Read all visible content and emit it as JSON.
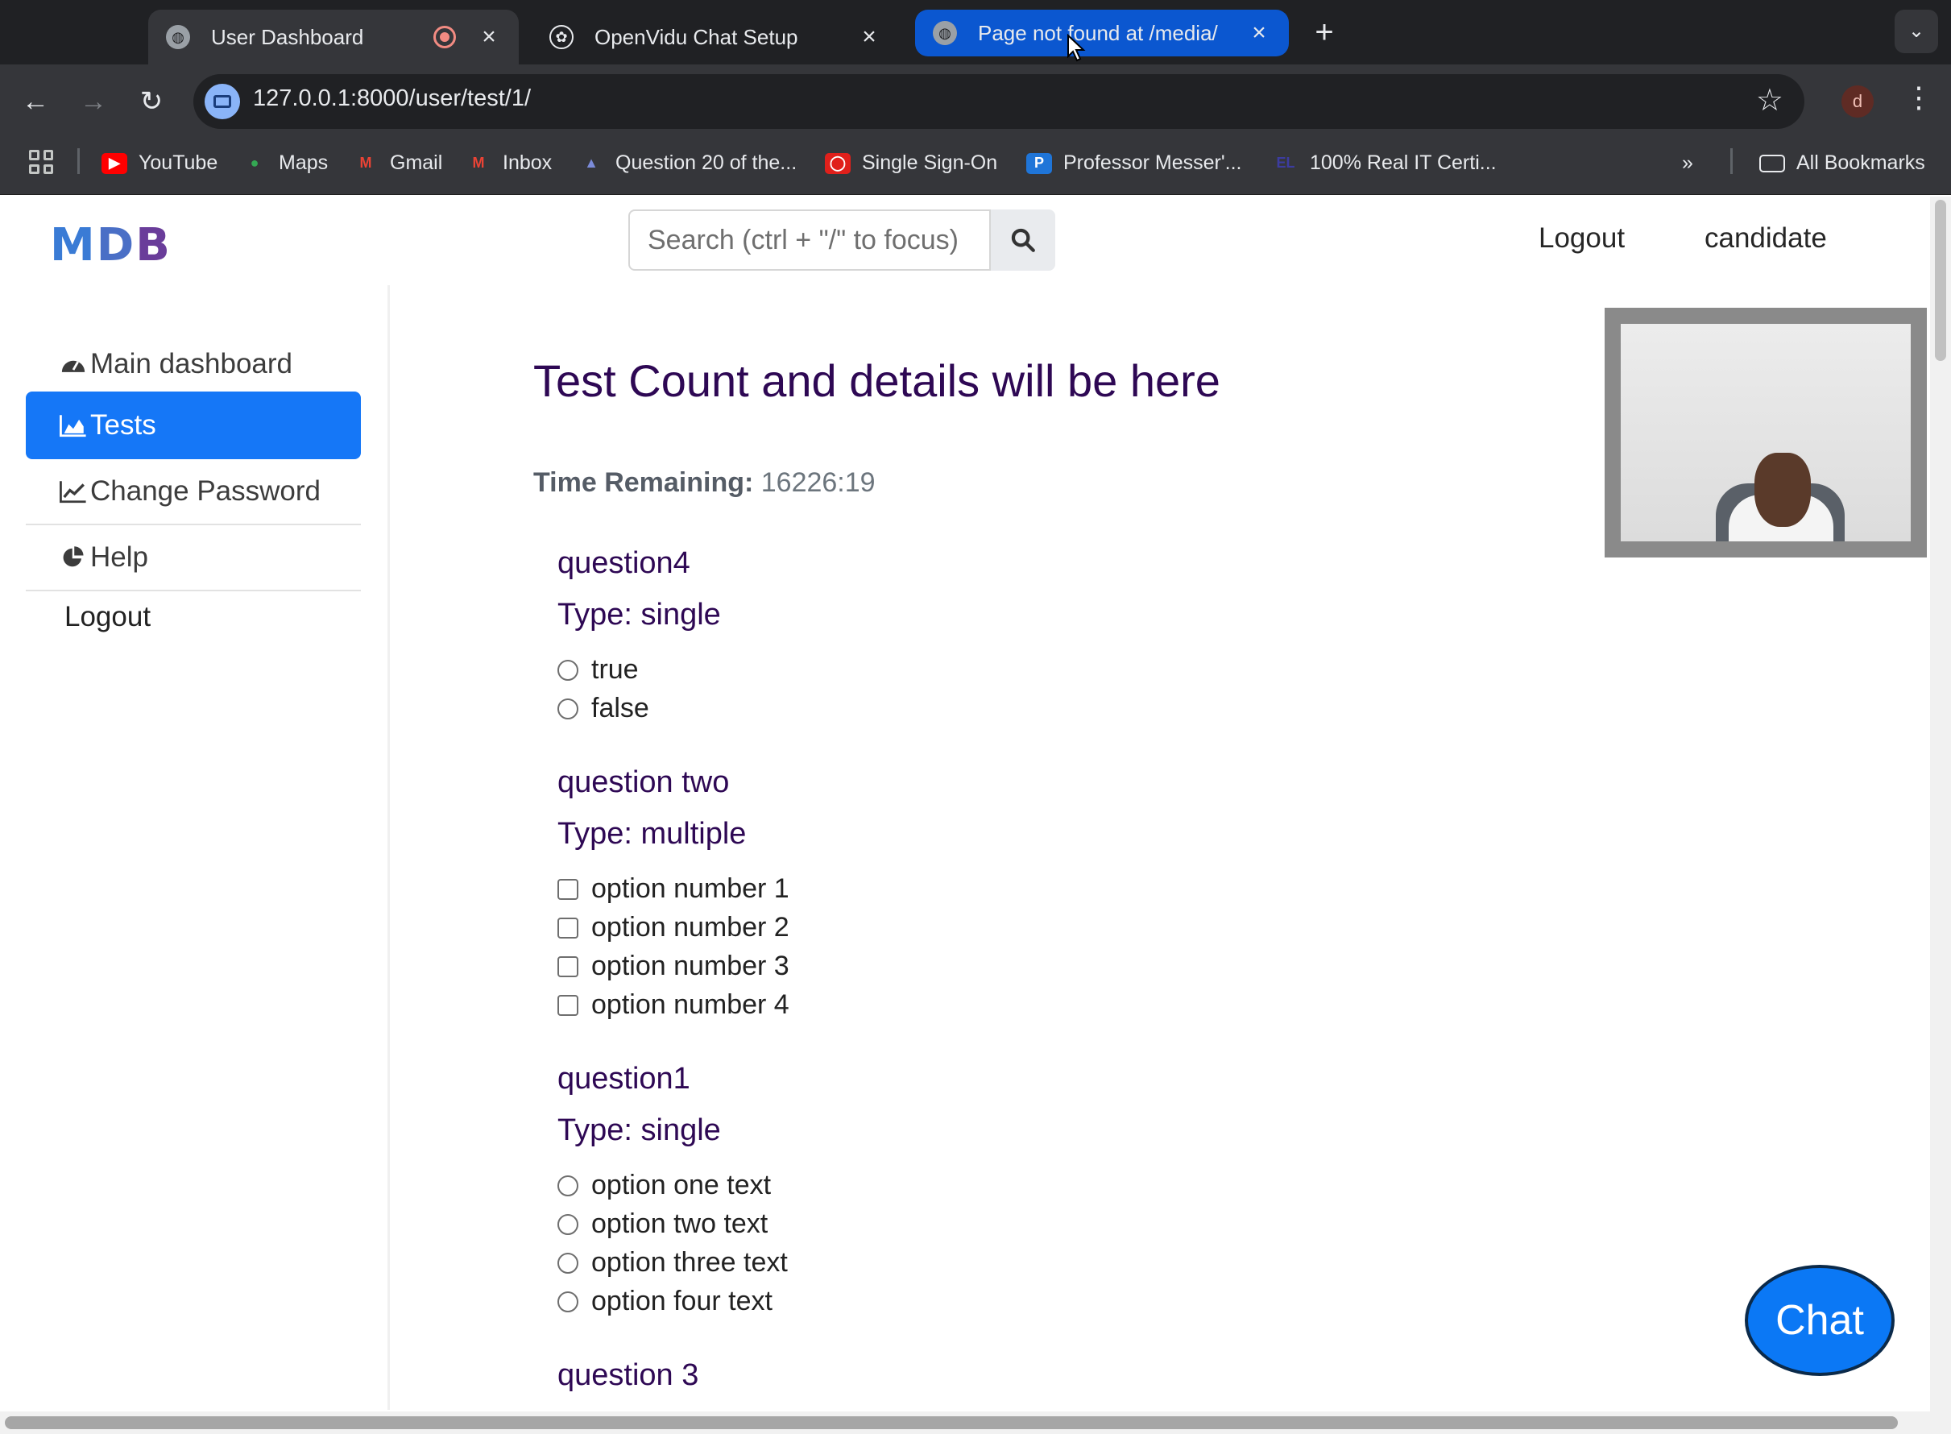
{
  "browser": {
    "tabs": [
      {
        "title": "User Dashboard",
        "recording": true
      },
      {
        "title": "OpenVidu Chat Setup"
      },
      {
        "title": "Page not found at /media/"
      }
    ],
    "url": "127.0.0.1:8000/user/test/1/",
    "profile_initial": "d",
    "bookmarks": [
      "YouTube",
      "Maps",
      "Gmail",
      "Inbox",
      "Question 20 of the...",
      "Single Sign-On",
      "Professor Messer'...",
      "100% Real IT Certi..."
    ],
    "all_bookmarks_label": "All Bookmarks"
  },
  "header": {
    "logo": {
      "m": "M",
      "d": "D",
      "b": "B"
    },
    "search_placeholder": "Search (ctrl + \"/\" to focus)",
    "nav": [
      "Logout",
      "candidate"
    ]
  },
  "sidebar": {
    "items": [
      {
        "label": "Main dashboard",
        "icon": "gauge-icon"
      },
      {
        "label": "Tests",
        "icon": "area-chart-icon",
        "active": true
      },
      {
        "label": "Change Password",
        "icon": "line-chart-icon"
      },
      {
        "label": "Help",
        "icon": "pie-chart-icon"
      },
      {
        "label": "Logout"
      }
    ]
  },
  "main": {
    "heading": "Test Count and details will be here",
    "timer_label": "Time Remaining:",
    "timer_value": "16226:19",
    "questions": [
      {
        "title": "question4",
        "type": "Type: single",
        "options": [
          "true",
          "false"
        ]
      },
      {
        "title": "question two",
        "type": "Type: multiple",
        "options": [
          "option number 1",
          "option number 2",
          "option number 3",
          "option number 4"
        ]
      },
      {
        "title": "question1",
        "type": "Type: single",
        "options": [
          "option one text",
          "option two text",
          "option three text",
          "option four text"
        ]
      },
      {
        "title": "question 3"
      }
    ]
  },
  "chat_button": "Chat",
  "colors": {
    "accent": "#1577f7",
    "heading": "#2e0854"
  }
}
